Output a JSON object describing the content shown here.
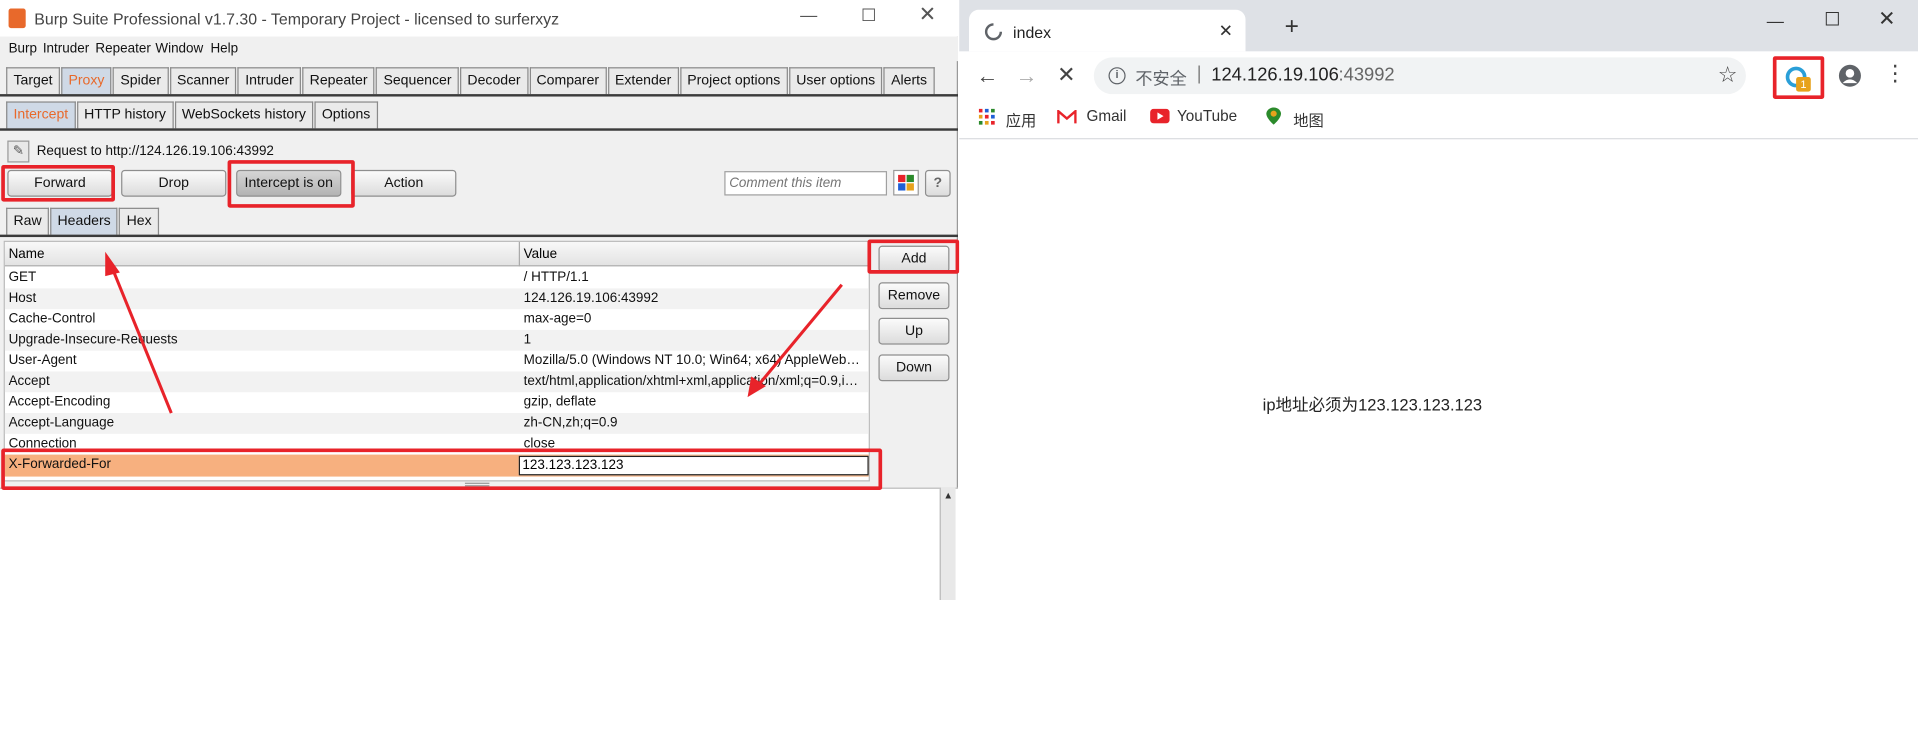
{
  "burp": {
    "title": "Burp Suite Professional v1.7.30 - Temporary Project - licensed to surferxyz",
    "menu": [
      "Burp",
      "Intruder",
      "Repeater",
      "Window",
      "Help"
    ],
    "main_tabs": [
      "Target",
      "Proxy",
      "Spider",
      "Scanner",
      "Intruder",
      "Repeater",
      "Sequencer",
      "Decoder",
      "Comparer",
      "Extender",
      "Project options",
      "User options",
      "Alerts"
    ],
    "proxy_tabs": [
      "Intercept",
      "HTTP history",
      "WebSockets history",
      "Options"
    ],
    "request_label": "Request to http://124.126.19.106:43992",
    "buttons": {
      "forward": "Forward",
      "drop": "Drop",
      "intercept": "Intercept is on",
      "action": "Action"
    },
    "comment_placeholder": "Comment this item",
    "help_label": "?",
    "view_tabs": [
      "Raw",
      "Headers",
      "Hex"
    ],
    "columns": {
      "name": "Name",
      "value": "Value"
    },
    "headers": [
      {
        "name": "GET",
        "value": "/ HTTP/1.1"
      },
      {
        "name": "Host",
        "value": "124.126.19.106:43992"
      },
      {
        "name": "Cache-Control",
        "value": "max-age=0"
      },
      {
        "name": "Upgrade-Insecure-Requests",
        "value": "1"
      },
      {
        "name": "User-Agent",
        "value": "Mozilla/5.0 (Windows NT 10.0; Win64; x64) AppleWebKi..."
      },
      {
        "name": "Accept",
        "value": "text/html,application/xhtml+xml,application/xml;q=0.9,im..."
      },
      {
        "name": "Accept-Encoding",
        "value": "gzip, deflate"
      },
      {
        "name": "Accept-Language",
        "value": "zh-CN,zh;q=0.9"
      },
      {
        "name": "Connection",
        "value": "close"
      },
      {
        "name": "X-Forwarded-For",
        "value": "123.123.123.123"
      }
    ],
    "side_buttons": {
      "add": "Add",
      "remove": "Remove",
      "up": "Up",
      "down": "Down"
    },
    "accent_color": "#e8692b",
    "annotation_color": "#e8232a"
  },
  "chrome": {
    "tab_title": "index",
    "insecure_label": "不安全",
    "url_host": "124.126.19.106",
    "url_port": ":43992",
    "extension_badge": "1",
    "bookmarks": [
      "应用",
      "Gmail",
      "YouTube",
      "地图"
    ],
    "page_message": "ip地址必须为123.123.123.123"
  }
}
